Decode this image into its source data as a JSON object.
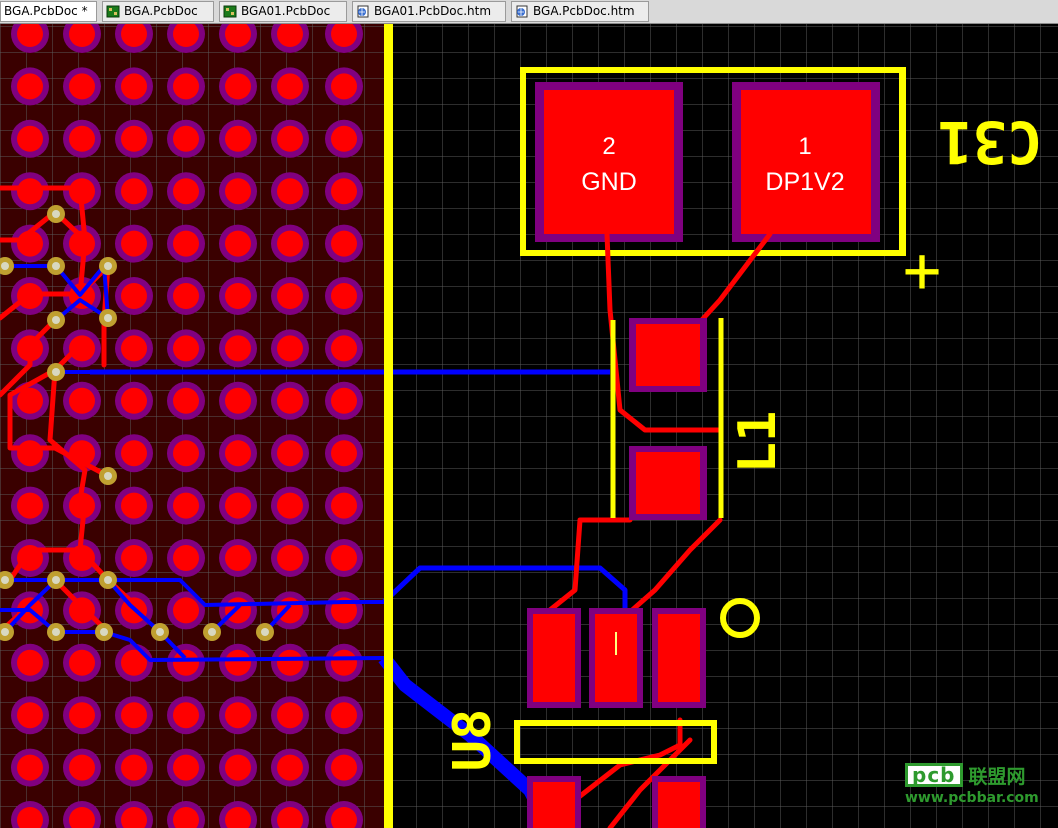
{
  "tabs": [
    {
      "label": "BGA.PcbDoc *",
      "icon": "pcb-board-icon",
      "active": true
    },
    {
      "label": "BGA.PcbDoc",
      "icon": "pcb-board-icon",
      "active": false
    },
    {
      "label": "BGA01.PcbDoc",
      "icon": "pcb-board-icon",
      "active": false
    },
    {
      "label": "BGA01.PcbDoc.htm",
      "icon": "html-document-icon",
      "active": false
    },
    {
      "label": "BGA.PcbDoc.htm",
      "icon": "html-document-icon",
      "active": false
    }
  ],
  "pcb": {
    "c31": {
      "designator": "C31",
      "pad2_number": "2",
      "pad2_net": "GND",
      "pad1_number": "1",
      "pad1_net": "DP1V2",
      "polarity_mark": "+"
    },
    "l1": {
      "designator": "L1"
    },
    "u8": {
      "designator": "U8"
    }
  },
  "watermark": {
    "logo": "pcb",
    "chinese": "联盟网",
    "url": "www.pcbbar.com"
  },
  "colors": {
    "background": "#000000",
    "grid": "#5a5a5a",
    "top_layer": "#ff0000",
    "bottom_layer": "#0000ff",
    "overlay": "#ffff00",
    "solder_mask": "#800080",
    "bga_fill": "#3a0000",
    "via": "#c0a030",
    "watermark_green": "#33a833"
  }
}
